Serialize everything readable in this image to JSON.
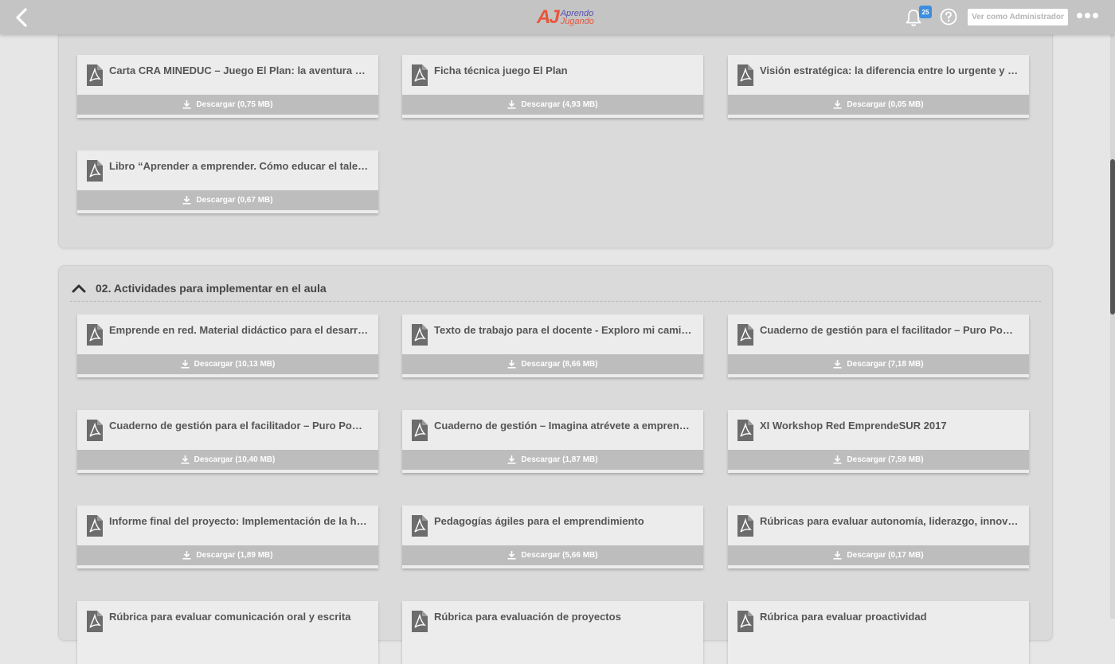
{
  "header": {
    "logo_mark": "AJ",
    "logo_line1": "Aprendo",
    "logo_line2": "Jugando",
    "notification_count": "25",
    "admin_button": "Ver como Administrador"
  },
  "sections": [
    {
      "title": "",
      "cards": [
        {
          "title": "Carta CRA MINEDUC – Juego El Plan: la aventura de emprender",
          "download": "Descargar (0,75 MB)"
        },
        {
          "title": "Ficha técnica juego El Plan",
          "download": "Descargar (4,93 MB)"
        },
        {
          "title": "Visión estratégica: la diferencia entre lo urgente y lo importante",
          "download": "Descargar (0,05 MB)"
        },
        {
          "title": "Libro “Aprender a emprender. Cómo educar el talento emprendedor”",
          "download": "Descargar (0,67 MB)"
        }
      ]
    },
    {
      "title": "02. Actividades para implementar en el aula",
      "cards": [
        {
          "title": "Emprende en red. Material didáctico para el desarrollo de la cultura emprendedora",
          "download": "Descargar (10,13 MB)"
        },
        {
          "title": "Texto de trabajo para el docente - Exploro mi camino",
          "download": "Descargar (8,66 MB)"
        },
        {
          "title": "Cuaderno de gestión para el facilitador – Puro Power Emprendedor",
          "download": "Descargar (7,18 MB)"
        },
        {
          "title": "Cuaderno de gestión para el facilitador – Puro Power Emprendedor II",
          "download": "Descargar (10,40 MB)"
        },
        {
          "title": "Cuaderno de gestión – Imagina atrévete a emprender",
          "download": "Descargar (1,87 MB)"
        },
        {
          "title": "XI Workshop Red EmprendeSUR 2017",
          "download": "Descargar (7,59 MB)"
        },
        {
          "title": "Informe final del proyecto: Implementación de la herramienta",
          "download": "Descargar (1,89 MB)"
        },
        {
          "title": "Pedagogías ágiles para el emprendimiento",
          "download": "Descargar (5,66 MB)"
        },
        {
          "title": "Rúbricas para evaluar autonomía, liderazgo, innovación y creatividad",
          "download": "Descargar (0,17 MB)"
        },
        {
          "title": "Rúbrica para evaluar comunicación oral y escrita",
          "download": ""
        },
        {
          "title": "Rúbrica para evaluación de proyectos",
          "download": ""
        },
        {
          "title": "Rúbrica para evaluar proactividad",
          "download": ""
        }
      ]
    }
  ]
}
